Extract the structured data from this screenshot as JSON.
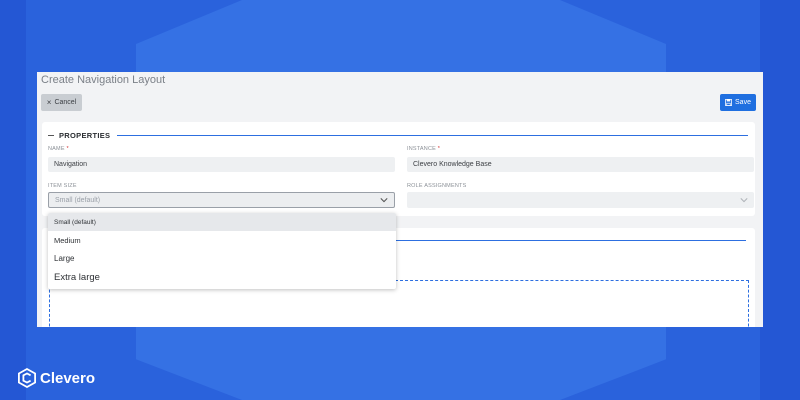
{
  "window": {
    "title": "Create Navigation Layout"
  },
  "toolbar": {
    "cancel_label": "Cancel",
    "save_label": "Save"
  },
  "properties": {
    "section_title": "PROPERTIES",
    "name": {
      "label": "NAME",
      "required_mark": "*",
      "value": "Navigation"
    },
    "instance": {
      "label": "INSTANCE",
      "required_mark": "*",
      "value": "Clevero Knowledge Base"
    },
    "item_size": {
      "label": "ITEM SIZE",
      "selected_text": "Small (default)",
      "options": [
        "Small (default)",
        "Medium",
        "Large",
        "Extra large"
      ]
    },
    "role_assignments": {
      "label": "ROLE ASSIGNMENTS",
      "value": ""
    }
  },
  "brand": {
    "name": "Clevero"
  },
  "colors": {
    "accent": "#1f6fe0",
    "background": "#2a62dc",
    "surface": "#f2f3f5"
  }
}
